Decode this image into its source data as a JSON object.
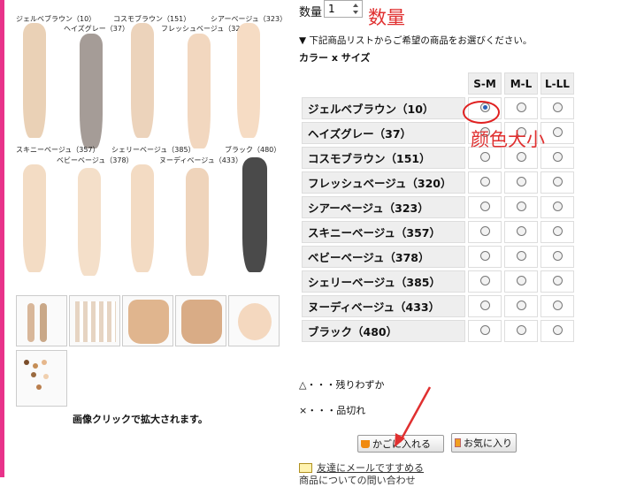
{
  "quantity": {
    "label": "数量",
    "value": "1",
    "annotation": "数量"
  },
  "instructions": "▼ 下記商品リストからご希望の商品をお選びください。",
  "table_title": "カラー x サイズ",
  "sizes": [
    "S-M",
    "M-L",
    "L-LL"
  ],
  "colors": [
    {
      "name": "ジェルベブラウン（10）"
    },
    {
      "name": "ヘイズグレー（37）"
    },
    {
      "name": "コスモブラウン（151）"
    },
    {
      "name": "フレッシュベージュ（320）"
    },
    {
      "name": "シアーベージュ（323）"
    },
    {
      "name": "スキニーベージュ（357）"
    },
    {
      "name": "ベビーベージュ（378）"
    },
    {
      "name": "シェリーベージュ（385）"
    },
    {
      "name": "ヌーディベージュ（433）"
    },
    {
      "name": "ブラック（480）"
    }
  ],
  "selected": {
    "color": "ジェルベブラウン（10）",
    "size": "S-M"
  },
  "color_size_annotation": "颜色大小",
  "legend_few": "△・・・残りわずか",
  "legend_out": "×・・・品切れ",
  "buttons": {
    "cart": "かごに入れる",
    "favorite": "お気に入り"
  },
  "mail_link": "友達にメールですすめる",
  "second_row_text": "商品についての問い合わせ",
  "gallery": {
    "labels_top": [
      "ジェルベブラウン（10）",
      "ヘイズグレー（37）",
      "コスモブラウン（151）",
      "フレッシュベージュ（320）",
      "シアーベージュ（323）"
    ],
    "labels_bottom": [
      "スキニーベージュ（357）",
      "ベビーベージュ（378）",
      "シェリーベージュ（385）",
      "ヌーディベージュ（433）",
      "ブラック（480）"
    ],
    "top_colors": [
      "#ead1b6",
      "#a59c97",
      "#ecd3bb",
      "#f2d7bf",
      "#f6dcc4"
    ],
    "bottom_colors": [
      "#f3dcc4",
      "#f4dfc9",
      "#f3dbc3",
      "#efd4bb",
      "#4a4a4a"
    ],
    "note": "画像クリックで拡大されます。"
  },
  "accent_colors": {
    "annotation_red": "#e03030",
    "left_bar": "#e8338a",
    "selected_radio": "#2a63b8"
  }
}
